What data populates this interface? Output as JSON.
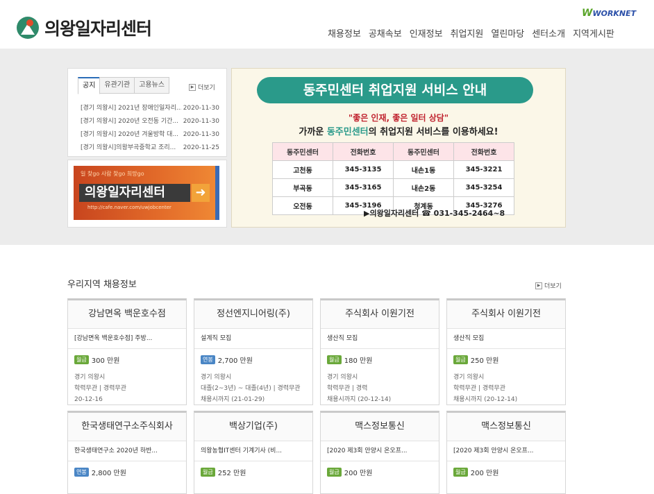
{
  "header": {
    "logo_text": "의왕일자리센터",
    "worknet": "WORKNET",
    "nav": [
      "채용정보",
      "공채속보",
      "인재정보",
      "취업지원",
      "열린마당",
      "센터소개",
      "지역게시판"
    ]
  },
  "notice": {
    "tabs": [
      "공지",
      "유관기관",
      "고용뉴스"
    ],
    "more": "더보기",
    "items": [
      {
        "title": "[경기 의왕시] 2021년 장애인일자리...",
        "date": "2020-11-30"
      },
      {
        "title": "[경기 의왕시] 2020년 오전동 기간...",
        "date": "2020-11-30"
      },
      {
        "title": "[경기 의왕시] 2020년 겨울방학 대...",
        "date": "2020-11-30"
      },
      {
        "title": "[경기 의왕시]의왕부곡중학교 조리...",
        "date": "2020-11-25"
      }
    ]
  },
  "cafe": {
    "small": "일 찾go 사람 찾go 희망go",
    "title": "의왕일자리센터",
    "url": "http://cafe.naver.com/uwjobcenter"
  },
  "banner": {
    "title": "동주민센터 취업지원 서비스 안내",
    "slogan": "\"좋은 인재, 좋은 일터 상담\"",
    "sub_prefix": "가까운 ",
    "sub_highlight": "동주민센터",
    "sub_suffix": "의 취업지원 서비스를 이용하세요!",
    "table_headers": [
      "동주민센터",
      "전화번호",
      "동주민센터",
      "전화번호"
    ],
    "table_rows": [
      [
        "고천동",
        "345-3135",
        "내손1동",
        "345-3221"
      ],
      [
        "부곡동",
        "345-3165",
        "내손2동",
        "345-3254"
      ],
      [
        "오전동",
        "345-3196",
        "청계동",
        "345-3276"
      ]
    ],
    "contact": "▶의왕일자리센터 ☎ 031-345-2464~8"
  },
  "jobs": {
    "section_title": "우리지역 채용정보",
    "more": "더보기",
    "cards": [
      {
        "company": "강남면옥 백운호수점",
        "job": "[강남면옥 백운호수점] 주방...",
        "pay_type": "월급",
        "pay": "300 만원",
        "location": "경기 의왕시",
        "cond": "학력무관 | 경력무관",
        "deadline": "20-12-16"
      },
      {
        "company": "정선엔지니어링(주)",
        "job": "설계직 모집",
        "pay_type": "연봉",
        "pay": "2,700 만원",
        "location": "경기 의왕시",
        "cond": "대졸(2~3년) ~ 대졸(4년) | 경력무관",
        "deadline": "채용시까지 (21-01-29)"
      },
      {
        "company": "주식회사 이원기전",
        "job": "생산직 모집",
        "pay_type": "월급",
        "pay": "180 만원",
        "location": "경기 의왕시",
        "cond": "학력무관 | 경력",
        "deadline": "채용시까지 (20-12-14)"
      },
      {
        "company": "주식회사 이원기전",
        "job": "생산직 모집",
        "pay_type": "월급",
        "pay": "250 만원",
        "location": "경기 의왕시",
        "cond": "학력무관 | 경력무관",
        "deadline": "채용시까지 (20-12-14)"
      },
      {
        "company": "한국생태연구소주식회사",
        "job": "한국생태연구소 2020년 하반...",
        "pay_type": "연봉",
        "pay": "2,800 만원",
        "location": "",
        "cond": "",
        "deadline": ""
      },
      {
        "company": "백상기업(주)",
        "job": "의왕농협IT센터 기계기사 (비...",
        "pay_type": "월급",
        "pay": "252 만원",
        "location": "",
        "cond": "",
        "deadline": ""
      },
      {
        "company": "맥스정보통신",
        "job": "[2020 제3회 안양시 온오프...",
        "pay_type": "월급",
        "pay": "200 만원",
        "location": "",
        "cond": "",
        "deadline": ""
      },
      {
        "company": "맥스정보통신",
        "job": "[2020 제3회 안양시 온오프...",
        "pay_type": "월급",
        "pay": "200 만원",
        "location": "",
        "cond": "",
        "deadline": ""
      }
    ]
  }
}
